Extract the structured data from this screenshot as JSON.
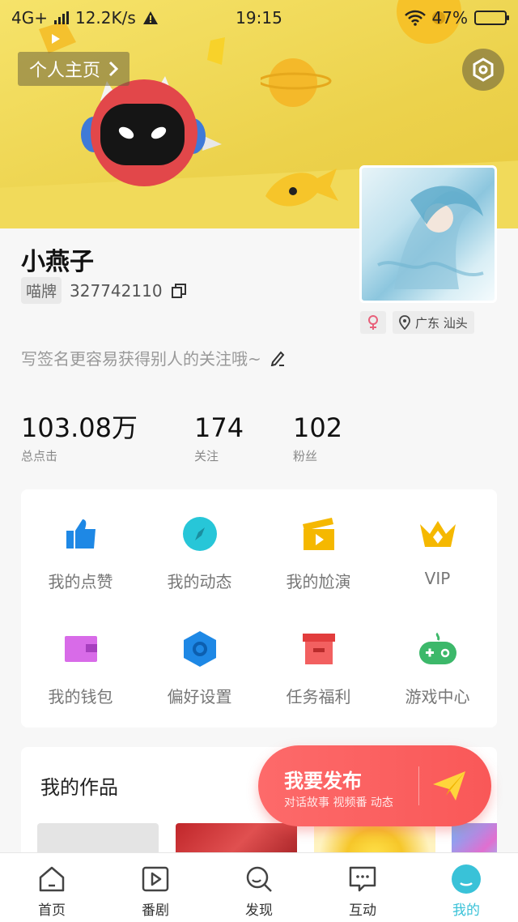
{
  "status_bar": {
    "network": "4G+",
    "speed": "12.2K/s",
    "time": "19:15",
    "battery": "47%",
    "battery_level": 0.47
  },
  "header": {
    "homepage_label": "个人主页"
  },
  "profile": {
    "name": "小燕子",
    "id_tag": "喵牌",
    "id_number": "327742110",
    "location": "广东 汕头",
    "signature": "写签名更容易获得别人的关注哦~"
  },
  "stats": [
    {
      "value": "103.08万",
      "label": "总点击"
    },
    {
      "value": "174",
      "label": "关注"
    },
    {
      "value": "102",
      "label": "粉丝"
    }
  ],
  "menu": [
    {
      "label": "我的点赞",
      "icon": "thumbs-up-icon"
    },
    {
      "label": "我的动态",
      "icon": "compass-icon"
    },
    {
      "label": "我的尬演",
      "icon": "clapperboard-icon"
    },
    {
      "label": "VIP",
      "icon": "crown-icon"
    },
    {
      "label": "我的钱包",
      "icon": "wallet-icon"
    },
    {
      "label": "偏好设置",
      "icon": "hexagon-settings-icon"
    },
    {
      "label": "任务福利",
      "icon": "gift-box-icon"
    },
    {
      "label": "游戏中心",
      "icon": "gamepad-icon"
    }
  ],
  "works": {
    "title": "我的作品"
  },
  "publish": {
    "title": "我要发布",
    "subtitle": "对话故事 视频番 动态"
  },
  "nav": [
    {
      "label": "首页",
      "icon": "home-icon"
    },
    {
      "label": "番剧",
      "icon": "play-icon"
    },
    {
      "label": "发现",
      "icon": "search-icon"
    },
    {
      "label": "互动",
      "icon": "chat-icon"
    },
    {
      "label": "我的",
      "icon": "profile-icon",
      "active": true
    }
  ],
  "colors": {
    "accent": "#39c2d8",
    "publish": "#f95858",
    "banner": "#ecd24c"
  }
}
